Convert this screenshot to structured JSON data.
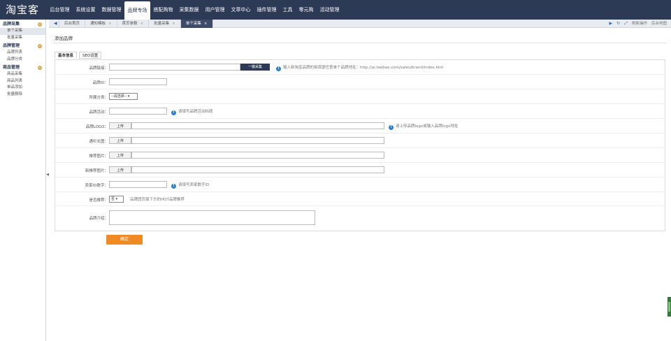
{
  "logo": "淘宝客",
  "top_nav": [
    "后台管理",
    "系统设置",
    "数据管理",
    "品牌专场",
    "搭配购物",
    "采集数据",
    "用户管理",
    "文章中心",
    "插件管理",
    "工具",
    "零元购",
    "活动管理"
  ],
  "tabs": [
    {
      "label": "后台首页",
      "closable": false
    },
    {
      "label": "通知模板",
      "closable": true
    },
    {
      "label": "首页参数",
      "closable": true
    },
    {
      "label": "批量采集",
      "closable": true
    },
    {
      "label": "单个采集",
      "closable": true,
      "active": true
    }
  ],
  "tab_tools": {
    "refresh_label": "刷新操作",
    "home_label": "后台地图"
  },
  "sidebar": [
    {
      "title": "品牌采集",
      "items": [
        "单个采集",
        "批量采集"
      ]
    },
    {
      "title": "品牌管理",
      "items": [
        "品牌列表",
        "品牌分类"
      ]
    },
    {
      "title": "商品管理",
      "items": [
        "商品采集",
        "商品列表",
        "单品添加",
        "批量删除"
      ]
    }
  ],
  "page_title": "添加品牌",
  "form_tabs": [
    "基本信息",
    "SEO设置"
  ],
  "form": {
    "brand_link": {
      "label": "品牌链接：",
      "button": "一键采集",
      "tip": "输入新淘宝品牌的拍观源任意单个品牌地址：http://ai.taobao.com/sales/brand/index.htm"
    },
    "brand_id": {
      "label": "品牌ID："
    },
    "category": {
      "label": "所属分类：",
      "selected": "--请选择--"
    },
    "brand_activity": {
      "label": "品牌活动：",
      "tip": "请填写品牌活动标题"
    },
    "brand_logo": {
      "label": "品牌LOGO：",
      "button": "上传",
      "tip": "请上传品牌logo或输入品牌logo地址"
    },
    "banner_image": {
      "label": "通栏长图：",
      "button": "上传"
    },
    "recommend_image": {
      "label": "推荐图片：",
      "button": "上传"
    },
    "new_image": {
      "label": "新推荐图片：",
      "button": "上传"
    },
    "seller_id": {
      "label": "卖家ID数字：",
      "tip": "请填写卖家数字ID"
    },
    "is_recommend": {
      "label": "是否推荐：",
      "selected": "否",
      "tip": "品牌团页面下方的HOT品牌推荐"
    },
    "intro": {
      "label": "品牌介绍："
    }
  },
  "confirm_label": "确定"
}
